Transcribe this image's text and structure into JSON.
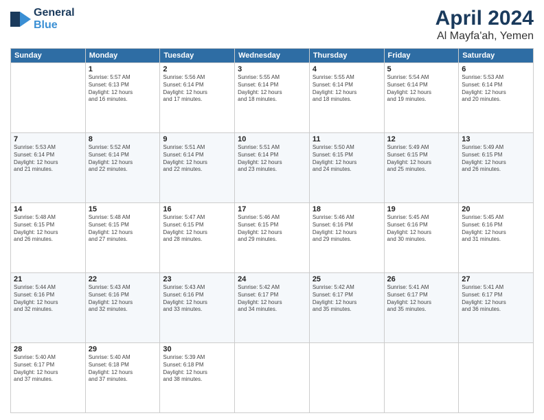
{
  "header": {
    "logo_line1": "General",
    "logo_line2": "Blue",
    "month": "April 2024",
    "location": "Al Mayfa'ah, Yemen"
  },
  "columns": [
    "Sunday",
    "Monday",
    "Tuesday",
    "Wednesday",
    "Thursday",
    "Friday",
    "Saturday"
  ],
  "weeks": [
    [
      {
        "day": "",
        "info": ""
      },
      {
        "day": "1",
        "info": "Sunrise: 5:57 AM\nSunset: 6:13 PM\nDaylight: 12 hours\nand 16 minutes."
      },
      {
        "day": "2",
        "info": "Sunrise: 5:56 AM\nSunset: 6:14 PM\nDaylight: 12 hours\nand 17 minutes."
      },
      {
        "day": "3",
        "info": "Sunrise: 5:55 AM\nSunset: 6:14 PM\nDaylight: 12 hours\nand 18 minutes."
      },
      {
        "day": "4",
        "info": "Sunrise: 5:55 AM\nSunset: 6:14 PM\nDaylight: 12 hours\nand 18 minutes."
      },
      {
        "day": "5",
        "info": "Sunrise: 5:54 AM\nSunset: 6:14 PM\nDaylight: 12 hours\nand 19 minutes."
      },
      {
        "day": "6",
        "info": "Sunrise: 5:53 AM\nSunset: 6:14 PM\nDaylight: 12 hours\nand 20 minutes."
      }
    ],
    [
      {
        "day": "7",
        "info": "Sunrise: 5:53 AM\nSunset: 6:14 PM\nDaylight: 12 hours\nand 21 minutes."
      },
      {
        "day": "8",
        "info": "Sunrise: 5:52 AM\nSunset: 6:14 PM\nDaylight: 12 hours\nand 22 minutes."
      },
      {
        "day": "9",
        "info": "Sunrise: 5:51 AM\nSunset: 6:14 PM\nDaylight: 12 hours\nand 22 minutes."
      },
      {
        "day": "10",
        "info": "Sunrise: 5:51 AM\nSunset: 6:14 PM\nDaylight: 12 hours\nand 23 minutes."
      },
      {
        "day": "11",
        "info": "Sunrise: 5:50 AM\nSunset: 6:15 PM\nDaylight: 12 hours\nand 24 minutes."
      },
      {
        "day": "12",
        "info": "Sunrise: 5:49 AM\nSunset: 6:15 PM\nDaylight: 12 hours\nand 25 minutes."
      },
      {
        "day": "13",
        "info": "Sunrise: 5:49 AM\nSunset: 6:15 PM\nDaylight: 12 hours\nand 26 minutes."
      }
    ],
    [
      {
        "day": "14",
        "info": "Sunrise: 5:48 AM\nSunset: 6:15 PM\nDaylight: 12 hours\nand 26 minutes."
      },
      {
        "day": "15",
        "info": "Sunrise: 5:48 AM\nSunset: 6:15 PM\nDaylight: 12 hours\nand 27 minutes."
      },
      {
        "day": "16",
        "info": "Sunrise: 5:47 AM\nSunset: 6:15 PM\nDaylight: 12 hours\nand 28 minutes."
      },
      {
        "day": "17",
        "info": "Sunrise: 5:46 AM\nSunset: 6:15 PM\nDaylight: 12 hours\nand 29 minutes."
      },
      {
        "day": "18",
        "info": "Sunrise: 5:46 AM\nSunset: 6:16 PM\nDaylight: 12 hours\nand 29 minutes."
      },
      {
        "day": "19",
        "info": "Sunrise: 5:45 AM\nSunset: 6:16 PM\nDaylight: 12 hours\nand 30 minutes."
      },
      {
        "day": "20",
        "info": "Sunrise: 5:45 AM\nSunset: 6:16 PM\nDaylight: 12 hours\nand 31 minutes."
      }
    ],
    [
      {
        "day": "21",
        "info": "Sunrise: 5:44 AM\nSunset: 6:16 PM\nDaylight: 12 hours\nand 32 minutes."
      },
      {
        "day": "22",
        "info": "Sunrise: 5:43 AM\nSunset: 6:16 PM\nDaylight: 12 hours\nand 32 minutes."
      },
      {
        "day": "23",
        "info": "Sunrise: 5:43 AM\nSunset: 6:16 PM\nDaylight: 12 hours\nand 33 minutes."
      },
      {
        "day": "24",
        "info": "Sunrise: 5:42 AM\nSunset: 6:17 PM\nDaylight: 12 hours\nand 34 minutes."
      },
      {
        "day": "25",
        "info": "Sunrise: 5:42 AM\nSunset: 6:17 PM\nDaylight: 12 hours\nand 35 minutes."
      },
      {
        "day": "26",
        "info": "Sunrise: 5:41 AM\nSunset: 6:17 PM\nDaylight: 12 hours\nand 35 minutes."
      },
      {
        "day": "27",
        "info": "Sunrise: 5:41 AM\nSunset: 6:17 PM\nDaylight: 12 hours\nand 36 minutes."
      }
    ],
    [
      {
        "day": "28",
        "info": "Sunrise: 5:40 AM\nSunset: 6:17 PM\nDaylight: 12 hours\nand 37 minutes."
      },
      {
        "day": "29",
        "info": "Sunrise: 5:40 AM\nSunset: 6:18 PM\nDaylight: 12 hours\nand 37 minutes."
      },
      {
        "day": "30",
        "info": "Sunrise: 5:39 AM\nSunset: 6:18 PM\nDaylight: 12 hours\nand 38 minutes."
      },
      {
        "day": "",
        "info": ""
      },
      {
        "day": "",
        "info": ""
      },
      {
        "day": "",
        "info": ""
      },
      {
        "day": "",
        "info": ""
      }
    ]
  ]
}
